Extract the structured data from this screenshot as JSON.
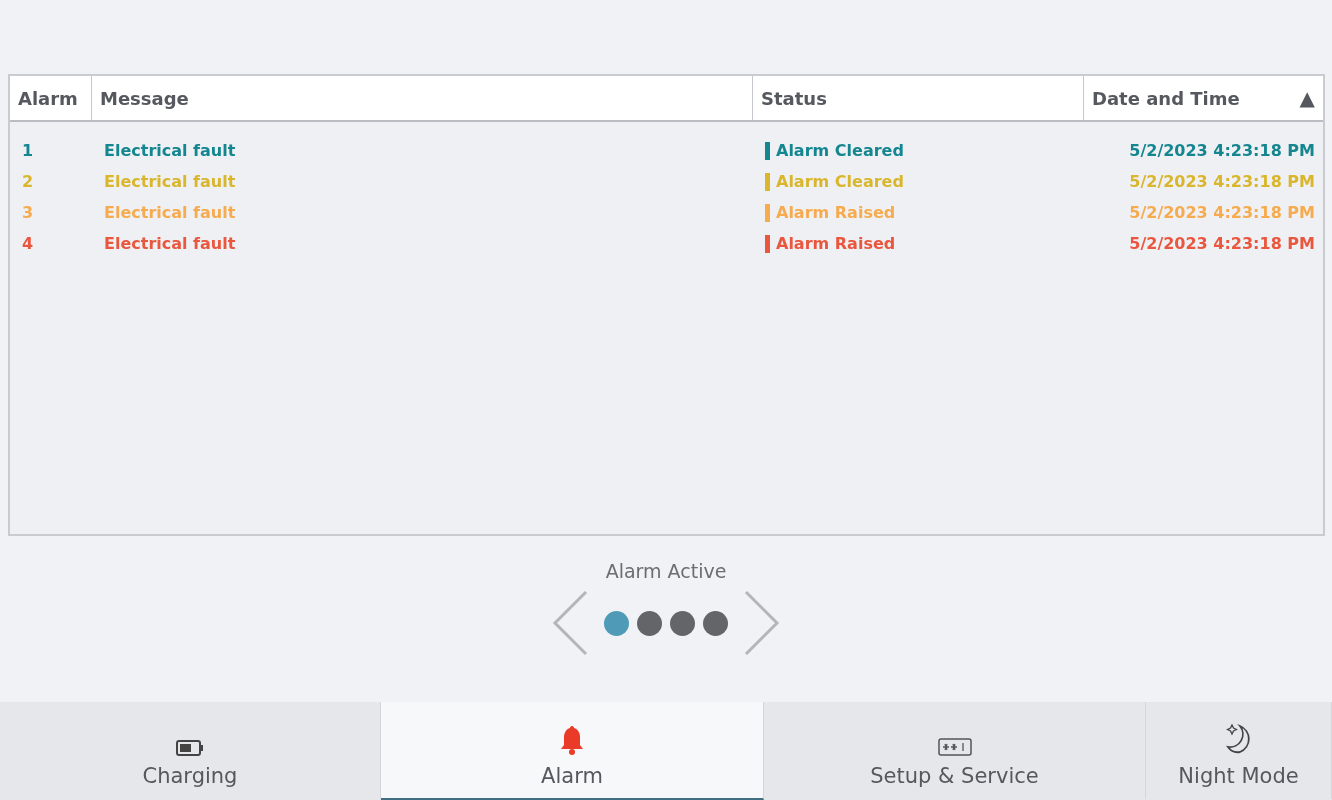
{
  "table": {
    "columns": [
      {
        "label": "Alarm"
      },
      {
        "label": "Message"
      },
      {
        "label": "Status"
      },
      {
        "label": "Date and Time",
        "sort_indicator": "▲"
      }
    ],
    "rows": [
      {
        "alarm": "1",
        "message": "Electrical fault",
        "status": "Alarm Cleared",
        "datetime": "5/2/2023 4:23:18 PM",
        "color": "#13868f"
      },
      {
        "alarm": "2",
        "message": "Electrical fault",
        "status": "Alarm Cleared",
        "datetime": "5/2/2023 4:23:18 PM",
        "color": "#d9b62c"
      },
      {
        "alarm": "3",
        "message": "Electrical fault",
        "status": "Alarm Raised",
        "datetime": "5/2/2023 4:23:18 PM",
        "color": "#f6ab4e"
      },
      {
        "alarm": "4",
        "message": "Electrical fault",
        "status": "Alarm Raised",
        "datetime": "5/2/2023 4:23:18 PM",
        "color": "#e9573f"
      }
    ]
  },
  "pager": {
    "label": "Alarm Active",
    "pages": [
      {
        "selected": true
      },
      {
        "selected": false
      },
      {
        "selected": false
      },
      {
        "selected": false
      }
    ]
  },
  "nav": [
    {
      "kind": "battery",
      "label": "Charging",
      "selected": false
    },
    {
      "kind": "bell",
      "label": "Alarm",
      "selected": true
    },
    {
      "kind": "keyboard",
      "label": "Setup & Service",
      "selected": false
    },
    {
      "kind": "moon",
      "label": "Night Mode",
      "selected": false
    }
  ]
}
